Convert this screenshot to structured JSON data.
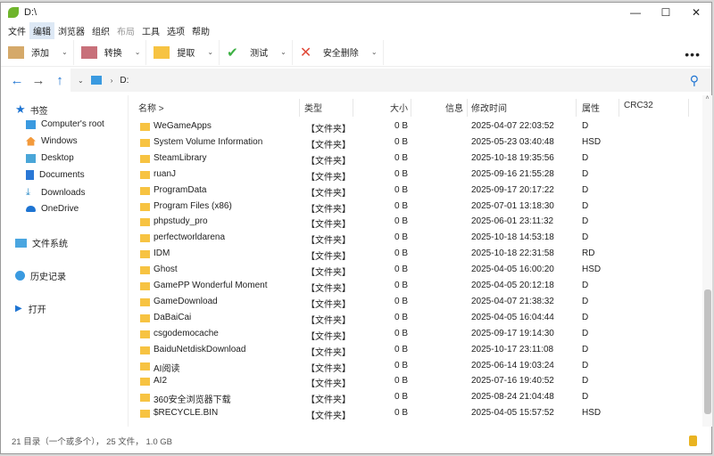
{
  "window": {
    "title": "D:\\",
    "min": "—",
    "max": "☐",
    "close": "✕"
  },
  "menu": [
    "文件",
    "编辑",
    "浏览器",
    "组织",
    "布局",
    "工具",
    "选项",
    "帮助"
  ],
  "toolbar": [
    {
      "label": "添加",
      "color": "#d5a96a"
    },
    {
      "label": "转换",
      "color": "#c8707a"
    },
    {
      "label": "提取",
      "color": "#f7c342"
    },
    {
      "label": "测试",
      "color": "#3cb043"
    },
    {
      "label": "安全删除",
      "color": "#e04b3a"
    }
  ],
  "toolbar_more": "•••",
  "address": {
    "path": "D:",
    "sep": "›",
    "chev": "⌄"
  },
  "sidebar": {
    "bookmarks": "书签",
    "items": [
      "Computer's root",
      "Windows",
      "Desktop",
      "Documents",
      "Downloads",
      "OneDrive"
    ],
    "filesystem": "文件系统",
    "history": "历史记录",
    "open": "打开"
  },
  "columns": {
    "name": "名称 >",
    "type": "类型",
    "size": "大小",
    "info": "信息",
    "mtime": "修改时间",
    "attr": "属性",
    "crc": "CRC32"
  },
  "rows": [
    [
      "WeGameApps",
      "【文件夹】",
      "0 B",
      "2025-04-07 22:03:52",
      "D"
    ],
    [
      "System Volume Information",
      "【文件夹】",
      "0 B",
      "2025-05-23 03:40:48",
      "HSD"
    ],
    [
      "SteamLibrary",
      "【文件夹】",
      "0 B",
      "2025-10-18 19:35:56",
      "D"
    ],
    [
      "ruanJ",
      "【文件夹】",
      "0 B",
      "2025-09-16 21:55:28",
      "D"
    ],
    [
      "ProgramData",
      "【文件夹】",
      "0 B",
      "2025-09-17 20:17:22",
      "D"
    ],
    [
      "Program Files (x86)",
      "【文件夹】",
      "0 B",
      "2025-07-01 13:18:30",
      "D"
    ],
    [
      "phpstudy_pro",
      "【文件夹】",
      "0 B",
      "2025-06-01 23:11:32",
      "D"
    ],
    [
      "perfectworldarena",
      "【文件夹】",
      "0 B",
      "2025-10-18 14:53:18",
      "D"
    ],
    [
      "IDM",
      "【文件夹】",
      "0 B",
      "2025-10-18 22:31:58",
      "RD"
    ],
    [
      "Ghost",
      "【文件夹】",
      "0 B",
      "2025-04-05 16:00:20",
      "HSD"
    ],
    [
      "GamePP Wonderful Moment",
      "【文件夹】",
      "0 B",
      "2025-04-05 20:12:18",
      "D"
    ],
    [
      "GameDownload",
      "【文件夹】",
      "0 B",
      "2025-04-07 21:38:32",
      "D"
    ],
    [
      "DaBaiCai",
      "【文件夹】",
      "0 B",
      "2025-04-05 16:04:44",
      "D"
    ],
    [
      "csgodemocache",
      "【文件夹】",
      "0 B",
      "2025-09-17 19:14:30",
      "D"
    ],
    [
      "BaiduNetdiskDownload",
      "【文件夹】",
      "0 B",
      "2025-10-17 23:11:08",
      "D"
    ],
    [
      "AI阅读",
      "【文件夹】",
      "0 B",
      "2025-06-14 19:03:24",
      "D"
    ],
    [
      "AI2",
      "【文件夹】",
      "0 B",
      "2025-07-16 19:40:52",
      "D"
    ],
    [
      "360安全浏览器下载",
      "【文件夹】",
      "0 B",
      "2025-08-24 21:04:48",
      "D"
    ],
    [
      "$RECYCLE.BIN",
      "【文件夹】",
      "0 B",
      "2025-04-05 15:57:52",
      "HSD"
    ]
  ],
  "status": "21 目录（一个或多个）， 25 文件， 1.0 GB"
}
